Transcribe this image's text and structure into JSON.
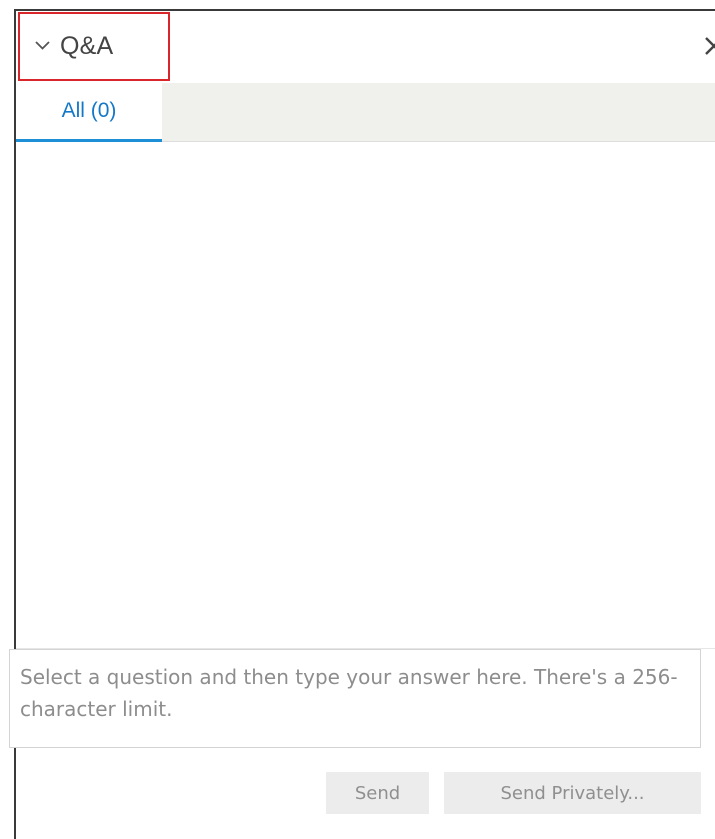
{
  "panel": {
    "title": "Q&A",
    "collapse_icon": "chevron-down-icon",
    "close_icon": "close-icon"
  },
  "tabs": [
    {
      "label": "All (0)",
      "active": true
    }
  ],
  "answer": {
    "value": "",
    "placeholder": "Select a question and then type your answer here. There's a 256-character limit."
  },
  "buttons": {
    "send_label": "Send",
    "send_privately_label": "Send Privately..."
  },
  "colors": {
    "accent": "#1478c8",
    "highlight_border": "#d9262b",
    "disabled_button_bg": "#ececec",
    "disabled_button_text": "#8f8f8f"
  }
}
